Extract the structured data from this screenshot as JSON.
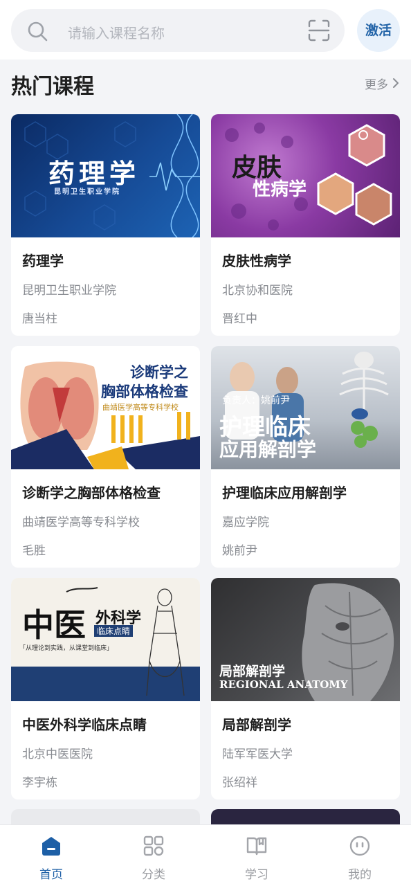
{
  "search": {
    "placeholder": "请输入课程名称",
    "activate_label": "激活"
  },
  "section": {
    "title": "热门课程",
    "more_label": "更多"
  },
  "courses": [
    {
      "title": "药理学",
      "org": "昆明卫生职业学院",
      "teacher": "唐当柱",
      "cover_title": "药理学",
      "cover_sub": "昆明卫生职业学院"
    },
    {
      "title": "皮肤性病学",
      "org": "北京协和医院",
      "teacher": "晋红中",
      "cover_title": "皮肤",
      "cover_sub": "性病学"
    },
    {
      "title": "诊断学之胸部体格检查",
      "org": "曲靖医学高等专科学校",
      "teacher": "毛胜",
      "cover_title": "诊断学之",
      "cover_sub": "胸部体格检查",
      "cover_org": "曲靖医学高等专科学校"
    },
    {
      "title": "护理临床应用解剖学",
      "org": "嘉应学院",
      "teacher": "姚前尹",
      "cover_owner": "负责人：姚前尹",
      "cover_title": "护理临床",
      "cover_sub": "应用解剖学"
    },
    {
      "title": "中医外科学临床点睛",
      "org": "北京中医医院",
      "teacher": "李宇栋",
      "cover_title": "中医",
      "cover_sub": "外科学",
      "cover_tag": "临床点睛",
      "cover_quote": "「从理论到实践，从课堂到临床」"
    },
    {
      "title": "局部解剖学",
      "org": "陆军军医大学",
      "teacher": "张绍祥",
      "cover_title": "局部解剖学",
      "cover_sub": "REGIONAL ANATOMY"
    }
  ],
  "nav": [
    {
      "label": "首页",
      "icon": "home-icon",
      "active": true
    },
    {
      "label": "分类",
      "icon": "category-icon",
      "active": false
    },
    {
      "label": "学习",
      "icon": "book-icon",
      "active": false
    },
    {
      "label": "我的",
      "icon": "profile-icon",
      "active": false
    }
  ],
  "colors": {
    "accent": "#1d5fa6",
    "background": "#f3f4f7"
  }
}
